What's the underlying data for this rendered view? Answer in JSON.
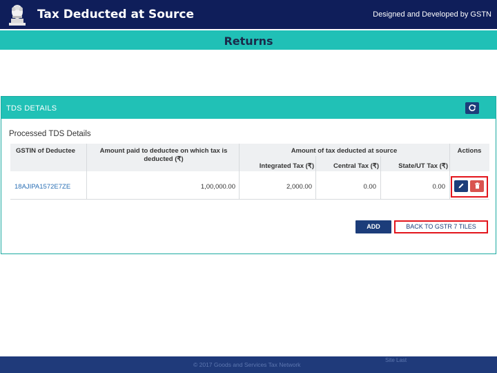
{
  "header": {
    "title": "Tax Deducted at Source",
    "credit": "Designed and Developed by GSTN",
    "emblem_icon": "state-emblem-icon"
  },
  "returns": {
    "title": "Returns"
  },
  "panel": {
    "title": "TDS DETAILS",
    "refresh_icon": "refresh-icon",
    "section_title": "Processed TDS Details",
    "table": {
      "headers": {
        "gstin": "GSTIN of Deductee",
        "amount_paid": "Amount paid to deductee on which tax is deducted (₹)",
        "tax_deducted": "Amount of tax deducted at source",
        "integrated": "Integrated Tax (₹)",
        "central": "Central Tax (₹)",
        "state": "State/UT Tax (₹)",
        "actions": "Actions"
      },
      "rows": [
        {
          "gstin": "18AJIPA1572E7ZE",
          "amount_paid": "1,00,000.00",
          "integrated": "2,000.00",
          "central": "0.00",
          "state": "0.00"
        }
      ]
    },
    "buttons": {
      "add": "ADD",
      "back": "BACK TO GSTR 7 TILES"
    }
  },
  "colors": {
    "header_bg": "#0f1e5a",
    "teal": "#21c1b6",
    "navy_button": "#1c3d7a",
    "delete_red": "#d9534f",
    "highlight_red": "#e3141b"
  },
  "footer": {
    "text": "© 2017 Goods and Services Tax Network",
    "right": "Site Last"
  }
}
